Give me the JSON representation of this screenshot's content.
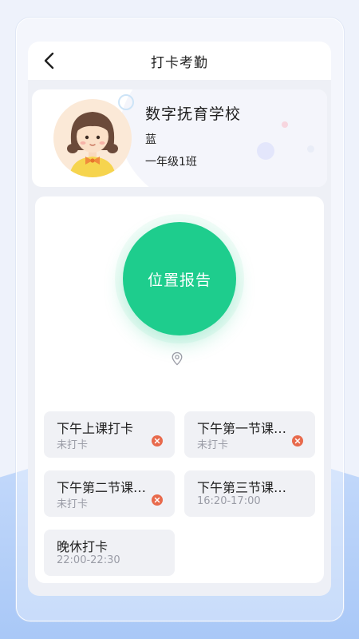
{
  "header": {
    "title": "打卡考勤",
    "back_icon": "chevron-left-icon"
  },
  "profile": {
    "school": "数字抚育学校",
    "student_name": "蓝",
    "class_name": "一年级1班"
  },
  "main": {
    "report_button": "位置报告",
    "location_icon": "map-pin-icon"
  },
  "checkins": [
    {
      "name": "下午上课打卡",
      "status": "未打卡",
      "missed": true
    },
    {
      "name": "下午第一节课…",
      "status": "未打卡",
      "missed": true
    },
    {
      "name": "下午第二节课…",
      "status": "未打卡",
      "missed": true
    },
    {
      "name": "下午第三节课…",
      "status": "16:20-17:00",
      "missed": false
    },
    {
      "name": "晚休打卡",
      "status": "22:00-22:30",
      "missed": false
    }
  ],
  "colors": {
    "accent": "#1ecd8d",
    "missed": "#e86a4c",
    "background": "#eef2fb"
  }
}
